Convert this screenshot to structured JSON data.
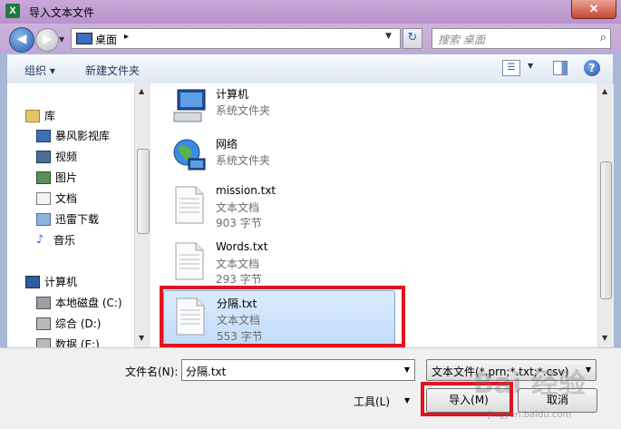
{
  "window": {
    "app_icon": "X",
    "title": "导入文本文件",
    "close_glyph": "✕"
  },
  "nav": {
    "back_glyph": "◀",
    "forward_glyph": "▶"
  },
  "address": {
    "location": "桌面",
    "separator": "▸"
  },
  "search": {
    "placeholder": "搜索 桌面"
  },
  "toolbar": {
    "organize_label": "组织 ▾",
    "new_folder_label": "新建文件夹"
  },
  "sidebar": {
    "items": [
      {
        "label": "库",
        "icon": "library-icon"
      },
      {
        "label": "暴风影视库",
        "icon": "media-library-icon"
      },
      {
        "label": "视频",
        "icon": "video-icon"
      },
      {
        "label": "图片",
        "icon": "pictures-icon"
      },
      {
        "label": "文档",
        "icon": "documents-icon"
      },
      {
        "label": "迅雷下载",
        "icon": "download-icon"
      },
      {
        "label": "音乐",
        "icon": "music-icon"
      },
      {
        "label": "计算机",
        "icon": "computer-icon"
      },
      {
        "label": "本地磁盘 (C:)",
        "icon": "drive-icon"
      },
      {
        "label": "综合 (D:)",
        "icon": "drive-icon"
      },
      {
        "label": "数据 (E:)",
        "icon": "drive-icon"
      }
    ]
  },
  "files": [
    {
      "name": "计算机",
      "type": "系统文件夹",
      "size": "",
      "icon": "computer-icon"
    },
    {
      "name": "网络",
      "type": "系统文件夹",
      "size": "",
      "icon": "network-icon"
    },
    {
      "name": "mission.txt",
      "type": "文本文档",
      "size": "903 字节",
      "icon": "text-file-icon"
    },
    {
      "name": "Words.txt",
      "type": "文本文档",
      "size": "293 字节",
      "icon": "text-file-icon"
    },
    {
      "name": "分隔.txt",
      "type": "文本文档",
      "size": "553 字节",
      "icon": "text-file-icon",
      "selected": true
    }
  ],
  "bottom": {
    "filename_label": "文件名(N):",
    "filename_value": "分隔.txt",
    "filter_value": "文本文件(*.prn;*.txt;*.csv)",
    "tools_label": "工具(L)",
    "import_label": "导入(M)",
    "cancel_label": "取消"
  },
  "watermark": {
    "text": "Bai 经验",
    "sub": "jingyan.baidu.com"
  },
  "colors": {
    "highlight": "#e0131f",
    "selection": "#c1dcfb"
  }
}
